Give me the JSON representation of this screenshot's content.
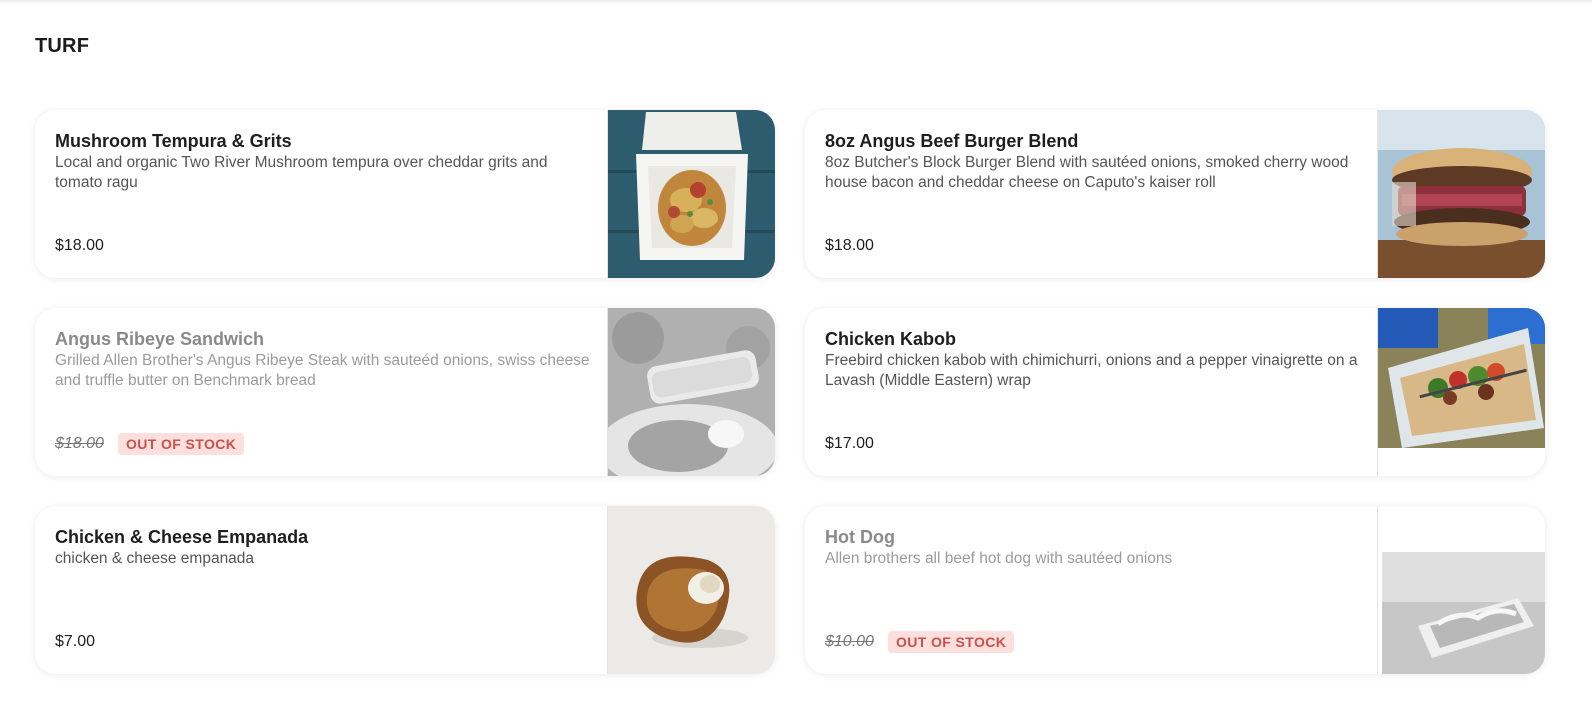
{
  "section": {
    "title": "TURF"
  },
  "out_of_stock_label": "OUT OF STOCK",
  "items": [
    {
      "name": "Mushroom Tempura & Grits",
      "description": "Local and organic Two River Mushroom tempura over cheddar grits and tomato ragu",
      "price": "$18.00",
      "out_of_stock": false
    },
    {
      "name": "8oz Angus Beef Burger Blend",
      "description": "8oz Butcher's Block Burger Blend with sautéed onions, smoked cherry wood house bacon and cheddar cheese on Caputo's kaiser roll",
      "price": "$18.00",
      "out_of_stock": false
    },
    {
      "name": "Angus Ribeye Sandwich",
      "description": "Grilled Allen Brother's Angus Ribeye Steak with sauteéd onions, swiss cheese and truffle butter on Benchmark bread",
      "price": "$18.00",
      "out_of_stock": true
    },
    {
      "name": "Chicken Kabob",
      "description": "Freebird chicken kabob with chimichurri, onions and a pepper vinaigrette on a Lavash (Middle Eastern) wrap",
      "price": "$17.00",
      "out_of_stock": false
    },
    {
      "name": "Chicken & Cheese Empanada",
      "description": "chicken & cheese empanada",
      "price": "$7.00",
      "out_of_stock": false
    },
    {
      "name": "Hot Dog",
      "description": "Allen brothers all beef hot dog with sautéed onions",
      "price": "$10.00",
      "out_of_stock": true
    }
  ]
}
